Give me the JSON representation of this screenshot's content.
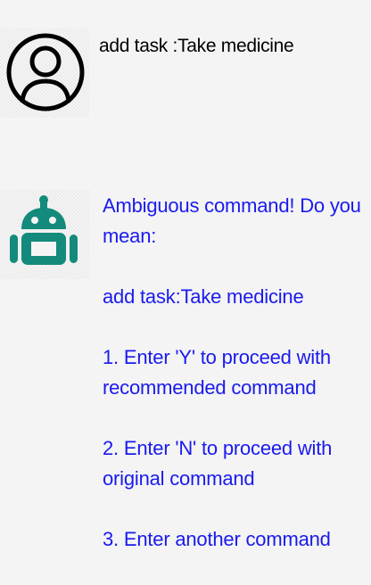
{
  "colors": {
    "background": "#f4f4f4",
    "user_text": "#000000",
    "bot_text": "#1a1aee",
    "bot_icon": "#138a7c"
  },
  "user_message": {
    "avatar_icon": "user-circle-icon",
    "text": "add task :Take medicine"
  },
  "bot_message": {
    "avatar_icon": "android-robot-icon",
    "intro": "Ambiguous command! Do you mean:",
    "suggestion": "add task:Take medicine",
    "option_1": "1. Enter 'Y' to proceed with recommended command",
    "option_2": "2. Enter 'N' to proceed with original command",
    "option_3": "3. Enter another command"
  }
}
